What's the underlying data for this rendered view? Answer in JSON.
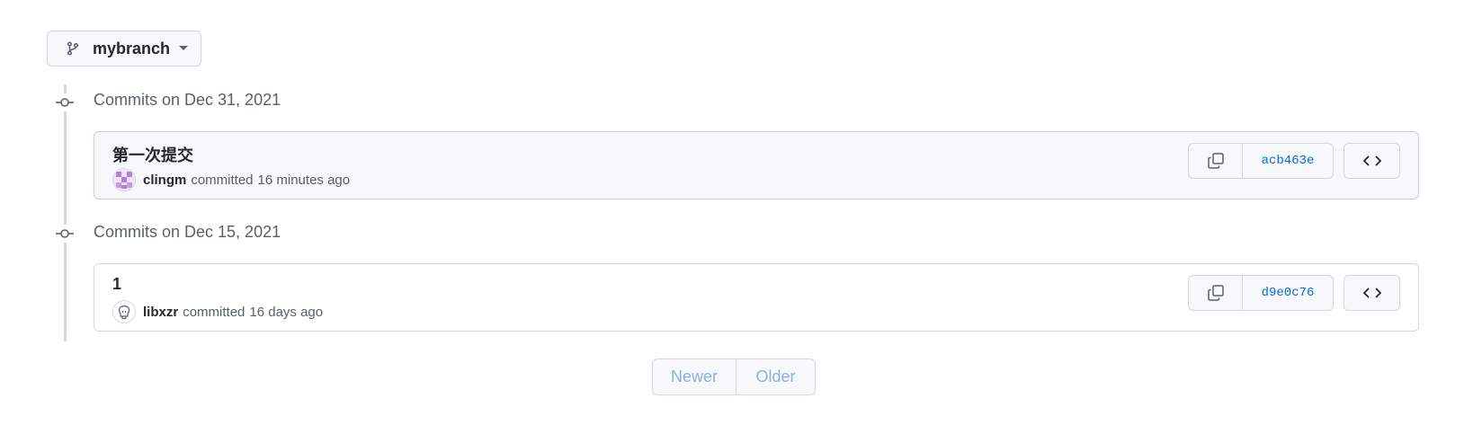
{
  "branch": {
    "name": "mybranch",
    "icon": "git-branch-icon"
  },
  "groups": [
    {
      "date_label": "Commits on Dec 31, 2021",
      "commits": [
        {
          "title": "第一次提交",
          "author": "clingm",
          "committed_word": "committed",
          "time_ago": "16 minutes ago",
          "sha": "acb463e",
          "highlighted": true
        }
      ]
    },
    {
      "date_label": "Commits on Dec 15, 2021",
      "commits": [
        {
          "title": "1",
          "author": "libxzr",
          "committed_word": "committed",
          "time_ago": "16 days ago",
          "sha": "d9e0c76",
          "highlighted": false
        }
      ]
    }
  ],
  "pagination": {
    "newer_label": "Newer",
    "older_label": "Older"
  },
  "colors": {
    "accent": "#0969da",
    "border": "#d0d7de",
    "muted": "#57606a",
    "disabled_link": "#8aaee6"
  }
}
